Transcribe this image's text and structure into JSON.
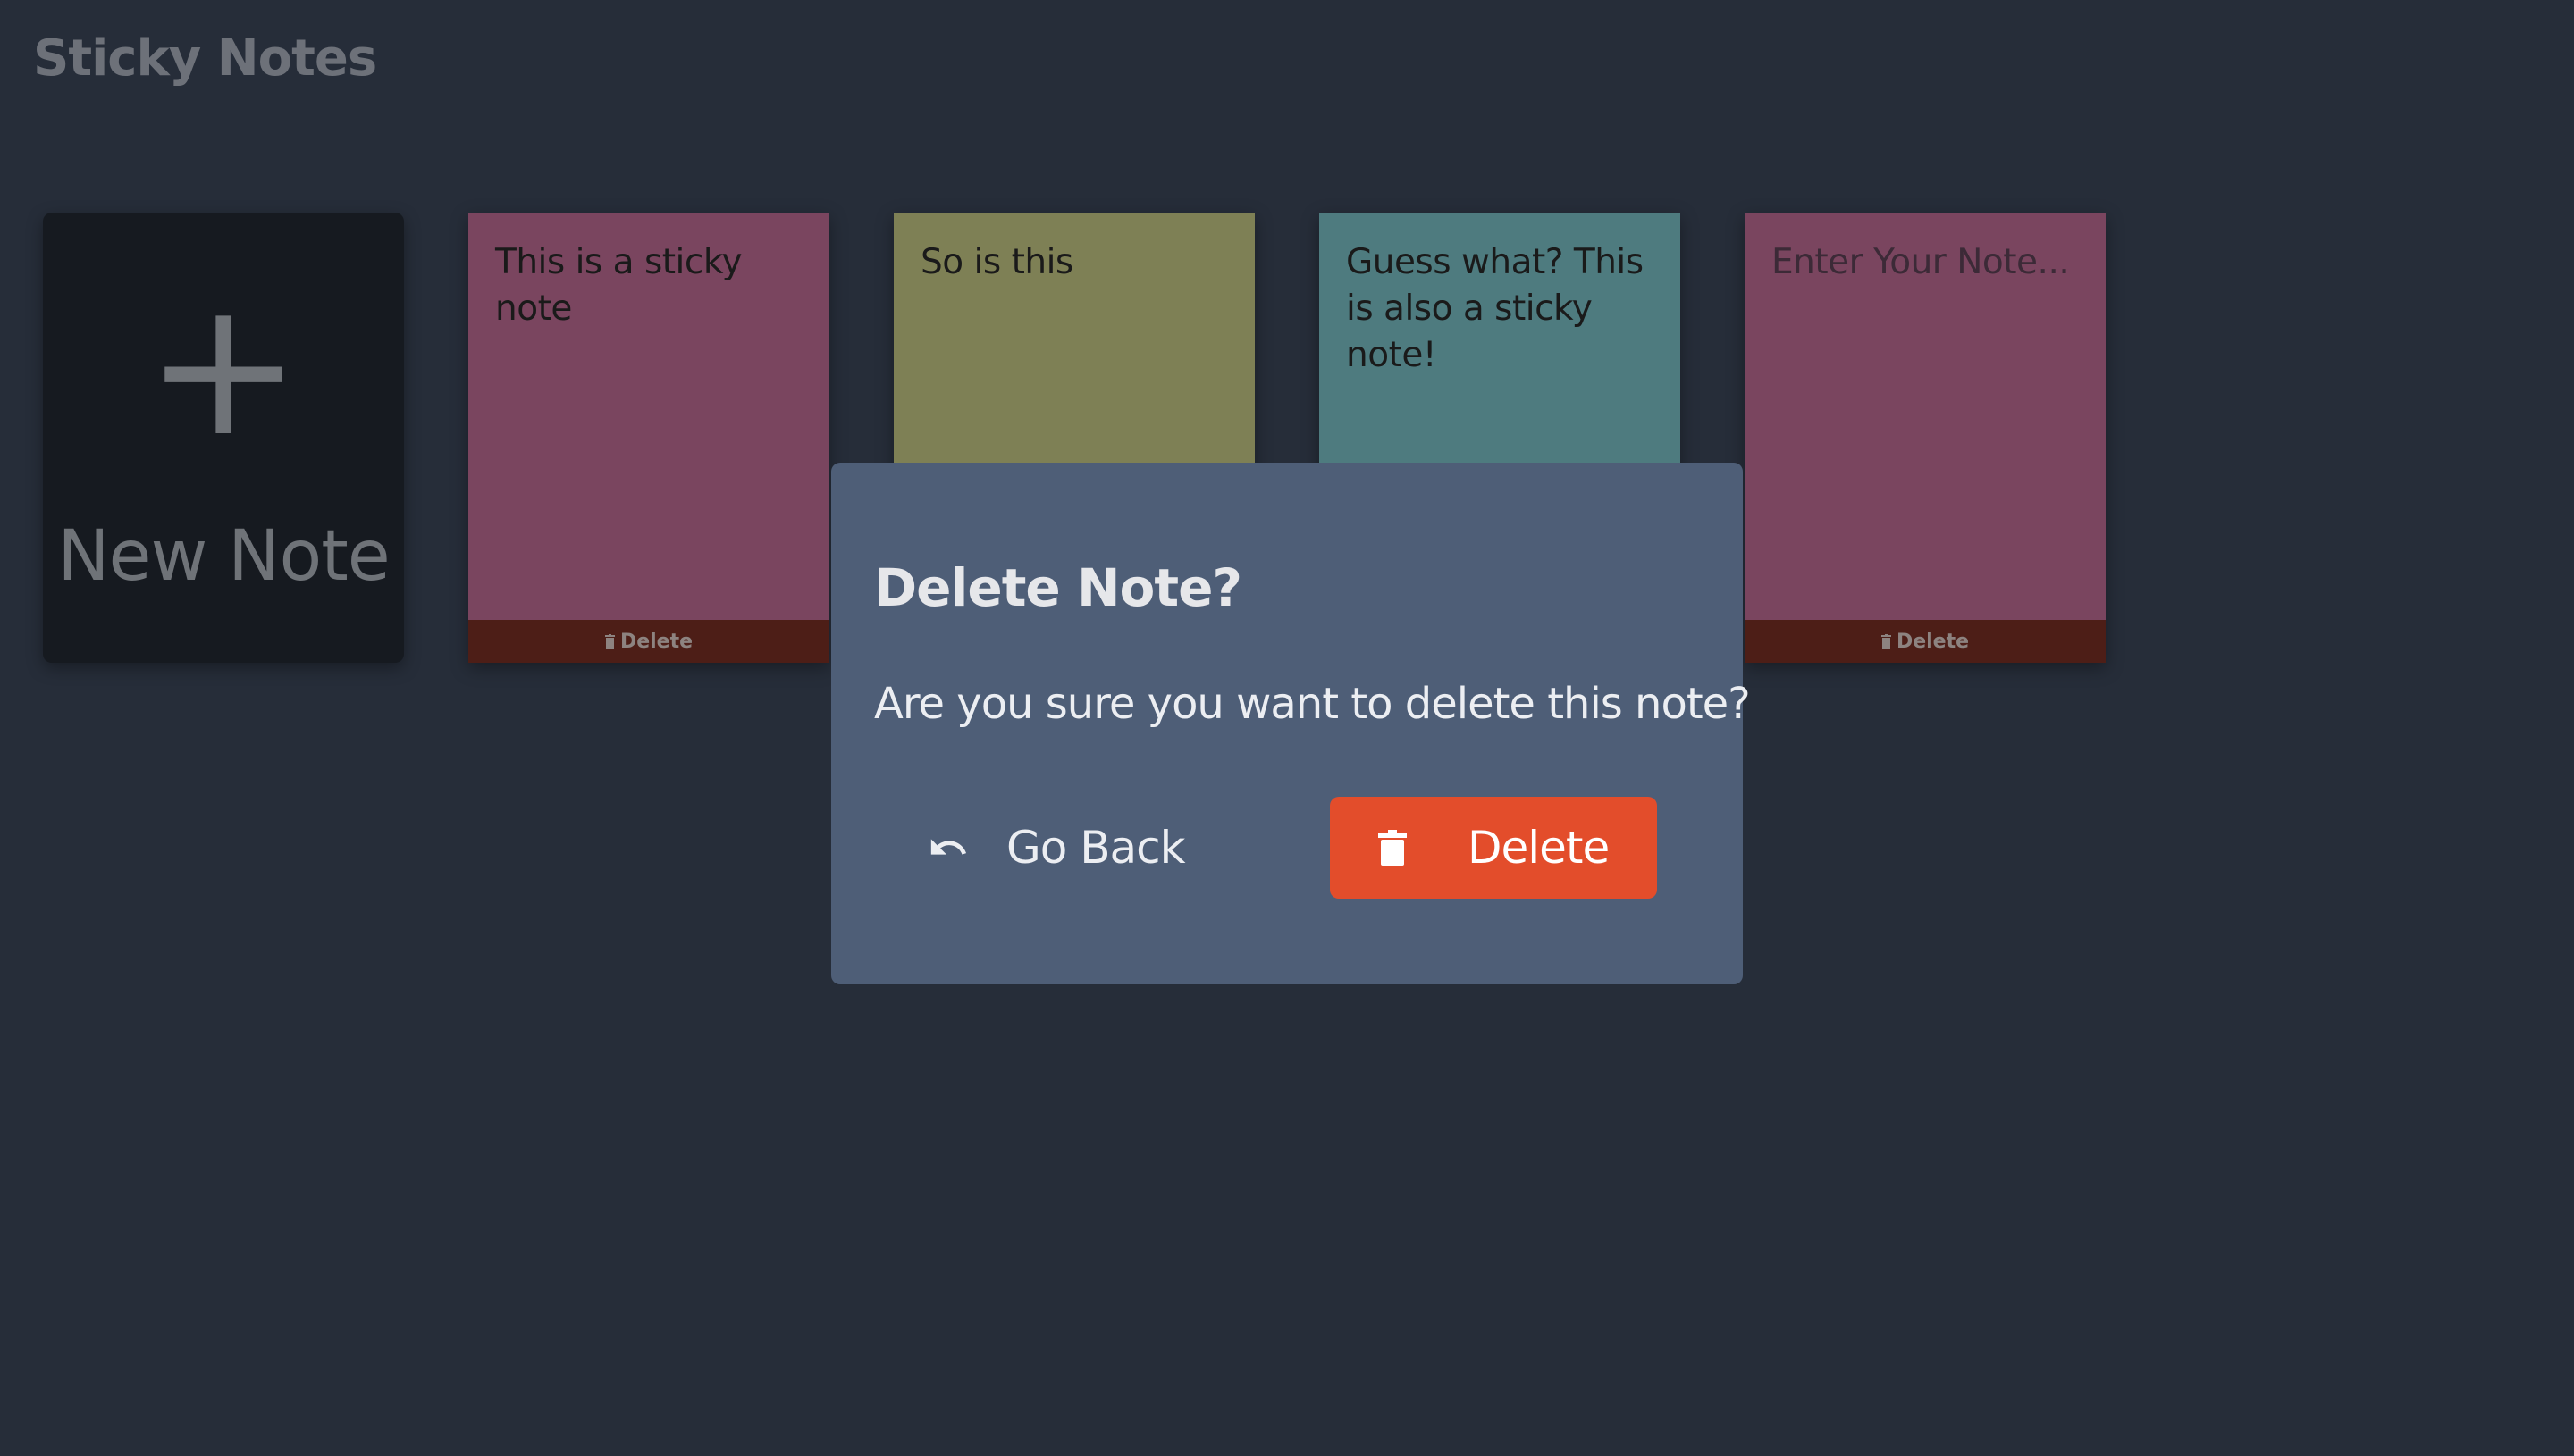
{
  "app": {
    "title": "Sticky Notes"
  },
  "new_note": {
    "icon": "+",
    "label": "New Note"
  },
  "notes": [
    {
      "text": "This is a sticky note",
      "color": "#7a455f",
      "delete_label": "Delete"
    },
    {
      "text": "So is this",
      "color": "#7e8055"
    },
    {
      "text": "Guess what? This is also a sticky note!",
      "color": "#4e7b7f"
    },
    {
      "text": "",
      "placeholder": "Enter Your Note...",
      "color": "#7a455f",
      "delete_label": "Delete"
    }
  ],
  "modal": {
    "title": "Delete Note?",
    "message": "Are you sure you want to delete this note?",
    "back_label": "Go Back",
    "back_icon": "undo-icon",
    "delete_label": "Delete",
    "delete_icon": "trash-icon",
    "delete_color": "#e34d2b",
    "background": "#4e5e77"
  },
  "colors": {
    "background": "#262d39",
    "footer": "#4d1e17"
  }
}
